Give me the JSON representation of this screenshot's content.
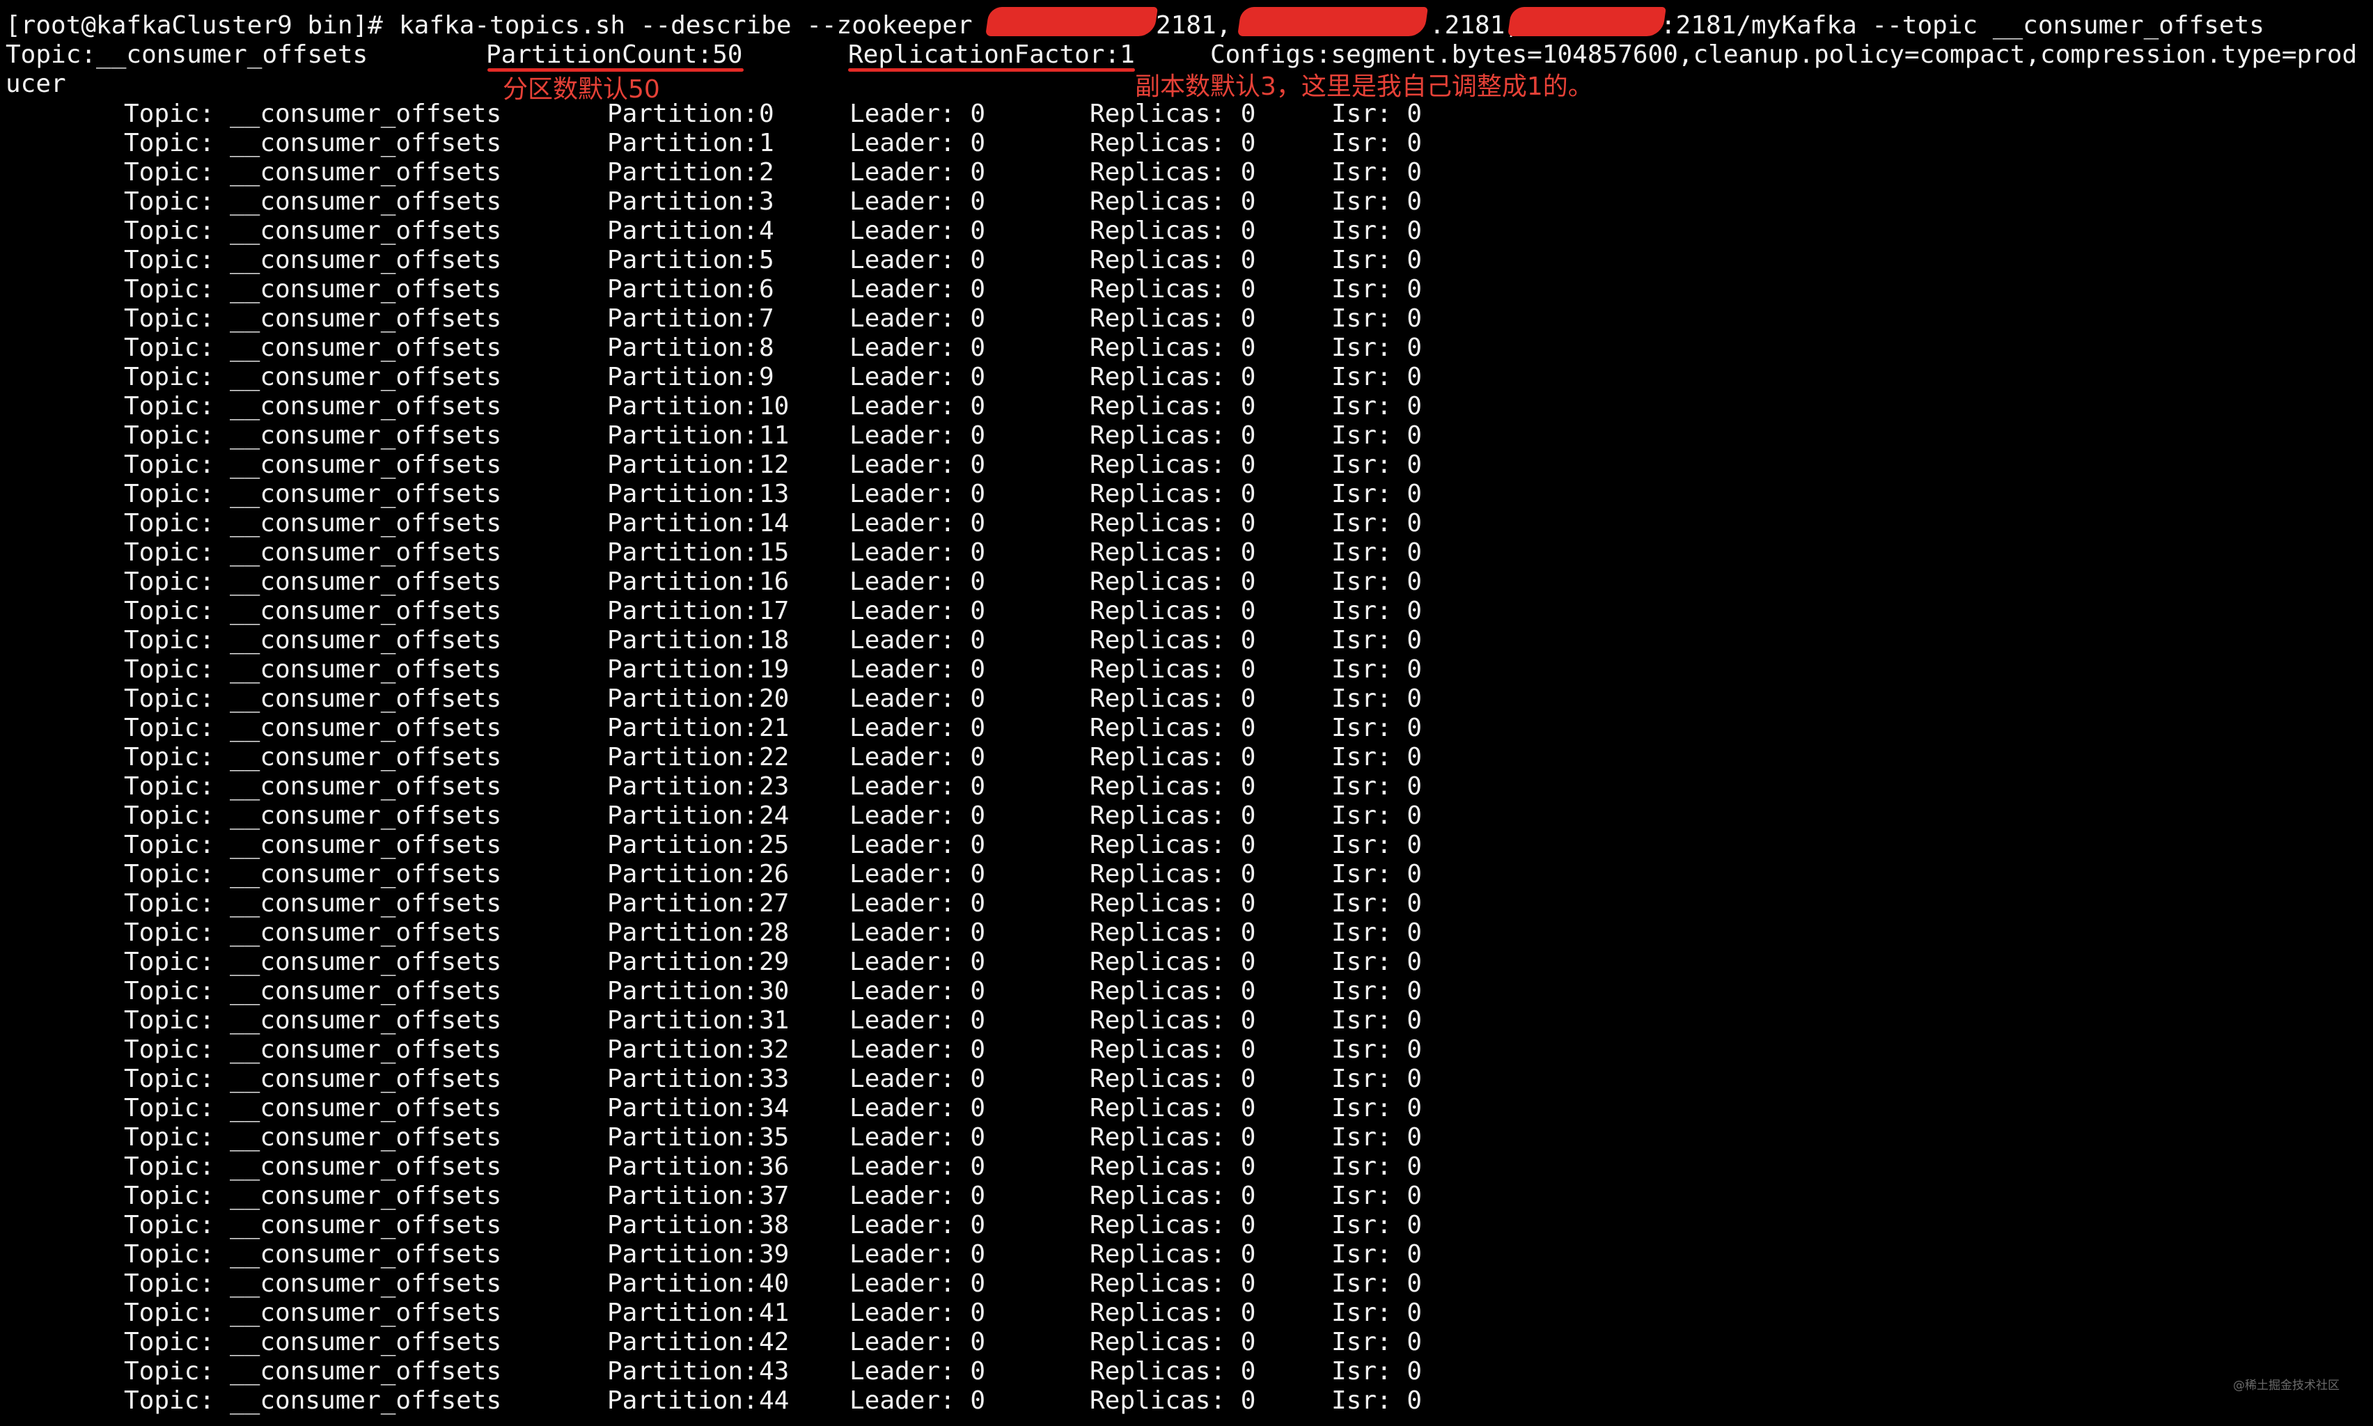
{
  "terminal": {
    "command_line": {
      "prompt": "[root@kafkaCluster9 bin]# ",
      "command": "kafka-topics.sh --describe --zookeeper ",
      "host1_tail": "2181,",
      "host2_tail": ".2181,",
      "host3_tail": ":2181/myKafka --topic __consumer_offsets"
    },
    "summary": {
      "topic": "Topic:__consumer_offsets",
      "partition_count": "PartitionCount:50",
      "replication_factor": "ReplicationFactor:1",
      "configs": "Configs:segment.bytes=104857600,cleanup.policy=compact,compression.type=prod",
      "configs_wrap": "ucer"
    },
    "annotations": {
      "partition_note": "分区数默认50",
      "replica_note": "副本数默认3，这里是我自己调整成1的。"
    },
    "row_labels": {
      "topic_label": "Topic:",
      "topic_value": "__consumer_offsets",
      "partition_label": "Partition:",
      "leader": "Leader: 0",
      "replicas": "Replicas: 0",
      "isr": "Isr: 0"
    },
    "partitions": [
      0,
      1,
      2,
      3,
      4,
      5,
      6,
      7,
      8,
      9,
      10,
      11,
      12,
      13,
      14,
      15,
      16,
      17,
      18,
      19,
      20,
      21,
      22,
      23,
      24,
      25,
      26,
      27,
      28,
      29,
      30,
      31,
      32,
      33,
      34,
      35,
      36,
      37,
      38,
      39,
      40,
      41,
      42,
      43,
      44
    ],
    "watermark": "@稀土掘金技术社区"
  },
  "colors": {
    "background": "#000000",
    "text": "#f2f2f2",
    "annotation": "#e32b26"
  }
}
